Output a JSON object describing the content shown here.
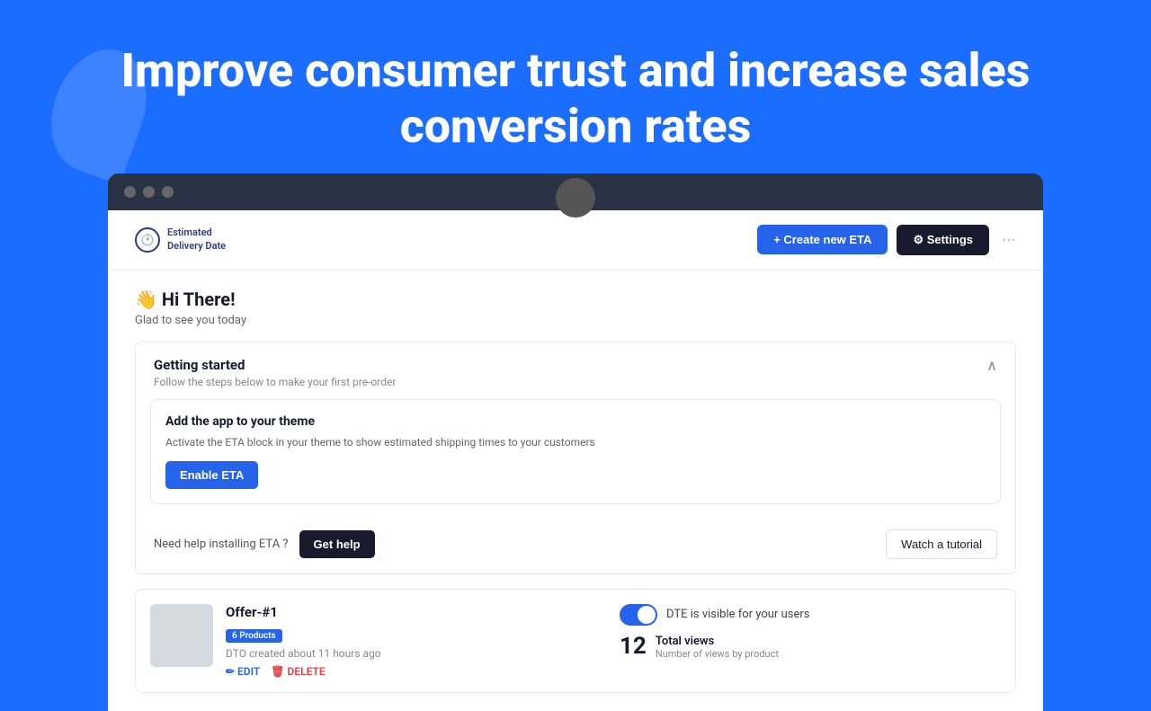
{
  "hero": {
    "title": "Improve consumer trust and increase sales conversion rates"
  },
  "browser": {
    "dots": [
      "dot1",
      "dot2",
      "dot3"
    ]
  },
  "app": {
    "logo_line1": "Estimated",
    "logo_line2": "Delivery Date",
    "create_btn": "+ Create new ETA",
    "settings_btn": "⚙ Settings"
  },
  "main": {
    "greeting": "👋 Hi There!",
    "greeting_sub": "Glad to see you today",
    "getting_started": {
      "title": "Getting started",
      "desc": "Follow the steps below to make your first pre-order",
      "add_app": {
        "title": "Add the app to your theme",
        "desc": "Activate the ETA block in your theme to show estimated shipping times to your customers",
        "btn": "Enable ETA"
      }
    },
    "help": {
      "text": "Need help installing ETA ?",
      "get_help_btn": "Get help",
      "watch_btn": "Watch a tutorial"
    },
    "offer": {
      "name": "Offer-#1",
      "badge": "6 Products",
      "date": "DTO created about 11 hours ago",
      "edit_label": "✏ EDIT",
      "delete_label": "🗑 DELETE",
      "toggle_label": "DTE is visible for your users",
      "total_views_number": "12",
      "total_views_title": "Total views",
      "total_views_desc": "Number of views by product"
    }
  }
}
